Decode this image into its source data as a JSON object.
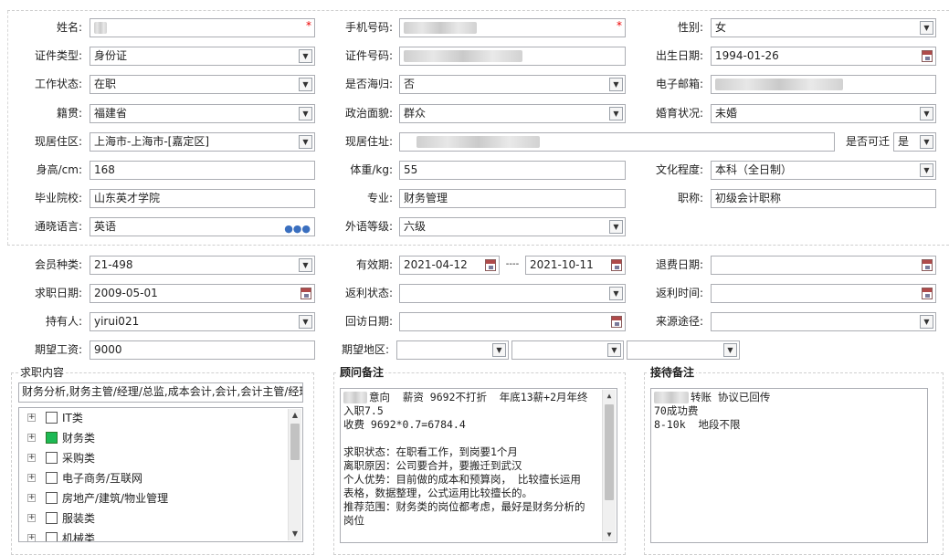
{
  "personal": {
    "name_label": "姓名:",
    "phone_label": "手机号码:",
    "gender_label": "性别:",
    "gender_value": "女",
    "id_type_label": "证件类型:",
    "id_type_value": "身份证",
    "id_no_label": "证件号码:",
    "birth_label": "出生日期:",
    "birth_value": "1994-01-26",
    "work_status_label": "工作状态:",
    "work_status_value": "在职",
    "returnee_label": "是否海归:",
    "returnee_value": "否",
    "email_label": "电子邮箱:",
    "native_label": "籍贯:",
    "native_value": "福建省",
    "political_label": "政治面貌:",
    "political_value": "群众",
    "marital_label": "婚育状况:",
    "marital_value": "未婚",
    "residence_label": "现居住区:",
    "residence_value": "上海市-上海市-[嘉定区]",
    "address_label": "现居住址:",
    "relocate_label": "是否可迁",
    "relocate_value": "是",
    "height_label": "身高/cm:",
    "height_value": "168",
    "weight_label": "体重/kg:",
    "weight_value": "55",
    "education_label": "文化程度:",
    "education_value": "本科（全日制）",
    "school_label": "毕业院校:",
    "school_value": "山东英才学院",
    "major_label": "专业:",
    "major_value": "财务管理",
    "title_label": "职称:",
    "title_value": "初级会计职称",
    "language_label": "通晓语言:",
    "language_value": "英语",
    "foreign_level_label": "外语等级:",
    "foreign_level_value": "六级"
  },
  "membership": {
    "member_type_label": "会员种类:",
    "member_type_value": "21-498",
    "validity_label": "有效期:",
    "valid_from": "2021-04-12",
    "valid_sep": "----",
    "valid_to": "2021-10-11",
    "refund_date_label": "退费日期:",
    "job_date_label": "求职日期:",
    "job_date_value": "2009-05-01",
    "rebate_status_label": "返利状态:",
    "rebate_time_label": "返利时间:",
    "holder_label": "持有人:",
    "holder_value": "yirui021",
    "visit_date_label": "回访日期:",
    "source_label": "来源途径:",
    "salary_label": "期望工资:",
    "salary_value": "9000",
    "region_label": "期望地区:"
  },
  "job_content": {
    "title": "求职内容",
    "summary": "财务分析,财务主管/经理/总监,成本会计,会计,会计主管/经理",
    "tree": [
      {
        "label": "IT类",
        "checked": false
      },
      {
        "label": "财务类",
        "checked": true
      },
      {
        "label": "采购类",
        "checked": false
      },
      {
        "label": "电子商务/互联网",
        "checked": false
      },
      {
        "label": "房地产/建筑/物业管理",
        "checked": false
      },
      {
        "label": "服装类",
        "checked": false
      },
      {
        "label": "机械类",
        "checked": false
      }
    ]
  },
  "consultant_notes": {
    "title": "顾问备注",
    "lines": [
      "意向  薪资 9692不打折  年底13薪+2月年终",
      "入职7.5",
      "收费 9692*0.7=6784.4",
      "",
      "求职状态：在职看工作，到岗要1个月",
      "离职原因：公司要合并，要搬迁到武汉",
      "个人优势：目前做的成本和预算岗， 比较擅长运用",
      "表格，数据整理，公式运用比较擅长的。",
      "推荐范围：财务类的岗位都考虑，最好是财务分析的",
      "岗位"
    ]
  },
  "reception_notes": {
    "title": "接待备注",
    "lines": [
      "转账 协议已回传",
      "70成功费",
      "8-10k  地段不限"
    ]
  },
  "colors": {
    "border": "#abadb3",
    "checkbox_on": "#1db954",
    "required": "#ee0000"
  }
}
